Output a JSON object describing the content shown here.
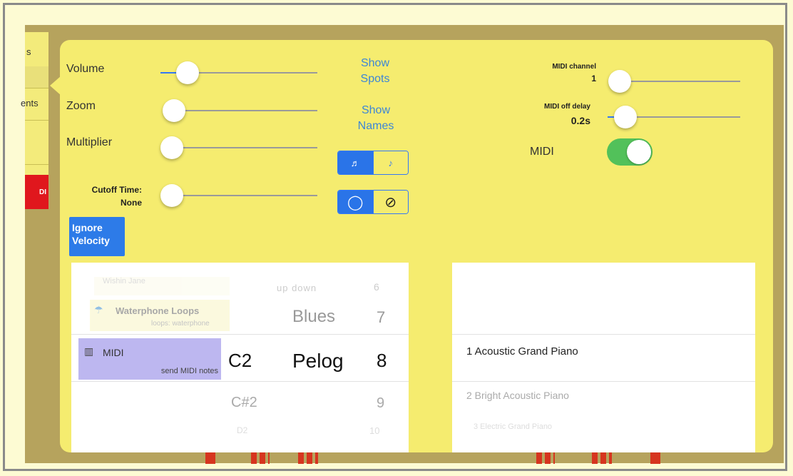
{
  "sidebar": {
    "tab1": "s",
    "tab2": "ents",
    "midi_tab": "DI"
  },
  "sliders": {
    "volume": {
      "label": "Volume",
      "level": 0.05
    },
    "zoom": {
      "label": "Zoom",
      "level": 0.0
    },
    "multiplier": {
      "label": "Multiplier",
      "level": 0.0
    },
    "cutoff": {
      "label_line1": "Cutoff Time:",
      "label_line2": "None",
      "level": 0.0
    }
  },
  "links": {
    "show_spots_1": "Show",
    "show_spots_2": "Spots",
    "show_names_1": "Show",
    "show_names_2": "Names"
  },
  "segments": {
    "notes": {
      "left_icon": "♬",
      "right_icon": "♪",
      "selected": "left"
    },
    "circle": {
      "left_icon": "◯",
      "right_icon": "⊘",
      "selected": "left"
    }
  },
  "ignore_velocity": {
    "line1": "Ignore",
    "line2": "Velocity"
  },
  "midi": {
    "channel_label": "MIDI channel",
    "channel_value": "1",
    "channel_level": 0.0,
    "off_delay_label": "MIDI off delay",
    "off_delay_value": "0.2s",
    "off_delay_level": 0.05,
    "toggle_label": "MIDI",
    "toggle_on": true
  },
  "picker_left": {
    "instruments": [
      {
        "name": "Wishin Jane",
        "sub": "(faded)"
      },
      {
        "name": "Waterphone Loops",
        "sub": "loops: waterphone"
      },
      {
        "name": "MIDI",
        "sub": "send MIDI notes"
      }
    ],
    "notes": [
      "C2",
      "C#2",
      "D2"
    ],
    "scales": [
      "up down",
      "Blues",
      "Pelog"
    ],
    "numbers": [
      "6",
      "7",
      "8",
      "9",
      "10"
    ]
  },
  "picker_right": {
    "items": [
      "1 Acoustic Grand Piano",
      "2 Bright Acoustic Piano",
      "3 Electric Grand Piano"
    ]
  }
}
